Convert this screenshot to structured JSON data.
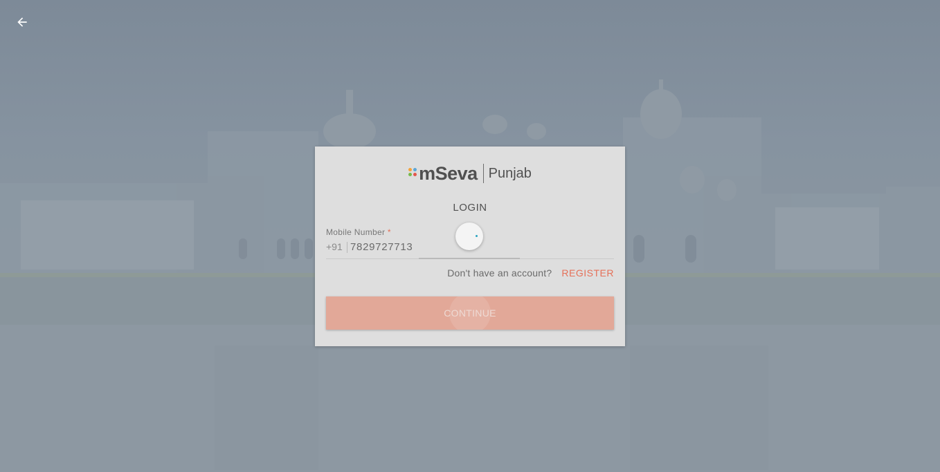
{
  "app": {
    "brand_name": "mSeva",
    "state_name": "Punjab",
    "logo_dot_colors": [
      "#f4a23a",
      "#5aa7d8",
      "#76b84a",
      "#e2574c"
    ]
  },
  "page": {
    "title": "LOGIN"
  },
  "form": {
    "mobile_label": "Mobile Number",
    "required_marker": "*",
    "country_code": "+91",
    "mobile_value": "7829727713"
  },
  "register": {
    "question": "Don't have an account?",
    "link_label": "REGISTER"
  },
  "actions": {
    "continue_label": "CONTINUE"
  },
  "colors": {
    "accent": "#e57058",
    "overlay_bg": "#8693a0",
    "card_bg": "#dedede",
    "spinner_accent": "#2aa4c0"
  },
  "state": {
    "loading": true
  }
}
